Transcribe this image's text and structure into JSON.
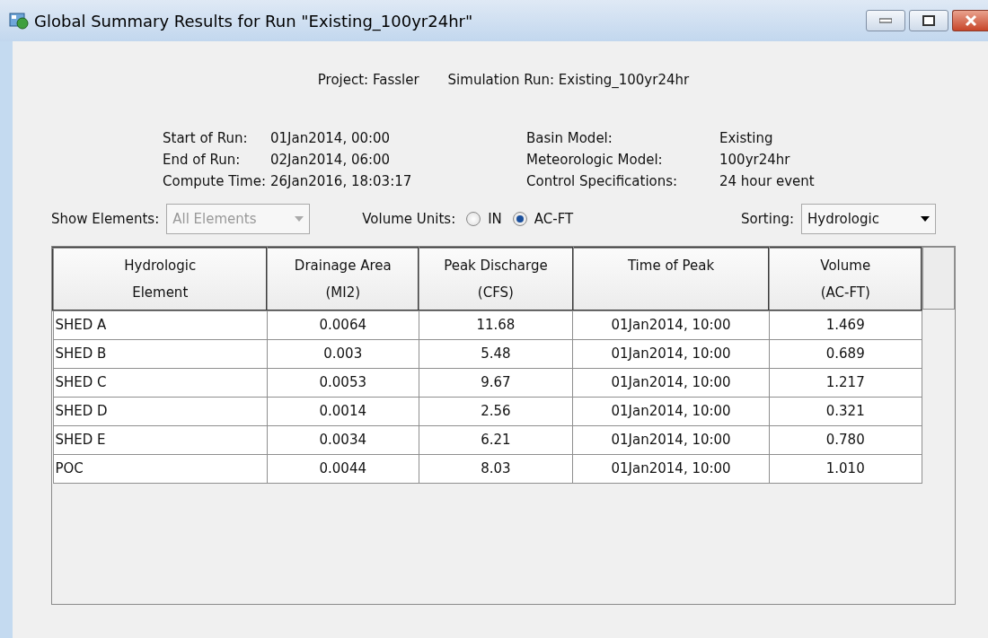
{
  "window": {
    "title": "Global Summary Results for Run \"Existing_100yr24hr\""
  },
  "header": {
    "project": {
      "label": "Project:",
      "value": "Fassler"
    },
    "simulation_run": {
      "label": "Simulation Run:",
      "value": "Existing_100yr24hr"
    }
  },
  "run_info_left": [
    {
      "label": "Start of Run:",
      "value": "01Jan2014, 00:00"
    },
    {
      "label": "End of Run:",
      "value": "02Jan2014, 06:00"
    },
    {
      "label": "Compute Time:",
      "value": "26Jan2016, 18:03:17"
    }
  ],
  "run_info_right": [
    {
      "label": "Basin Model:",
      "value": "Existing"
    },
    {
      "label": "Meteorologic Model:",
      "value": "100yr24hr"
    },
    {
      "label": "Control Specifications:",
      "value": "24 hour event"
    }
  ],
  "show_elements": {
    "label": "Show Elements:",
    "value": "All Elements",
    "disabled": true
  },
  "volume_units": {
    "label": "Volume Units:",
    "options": [
      {
        "label": "IN",
        "selected": false
      },
      {
        "label": "AC-FT",
        "selected": true
      }
    ]
  },
  "sorting": {
    "label": "Sorting:",
    "value": "Hydrologic"
  },
  "table": {
    "columns": [
      "Hydrologic\nElement",
      "Drainage Area\n(MI2)",
      "Peak Discharge\n(CFS)",
      "Time of Peak",
      "Volume\n(AC-FT)"
    ],
    "rows": [
      [
        "SHED A",
        "0.0064",
        "11.68",
        "01Jan2014, 10:00",
        "1.469"
      ],
      [
        "SHED B",
        "0.003",
        "5.48",
        "01Jan2014, 10:00",
        "0.689"
      ],
      [
        "SHED C",
        "0.0053",
        "9.67",
        "01Jan2014, 10:00",
        "1.217"
      ],
      [
        "SHED D",
        "0.0014",
        "2.56",
        "01Jan2014, 10:00",
        "0.321"
      ],
      [
        "SHED E",
        "0.0034",
        "6.21",
        "01Jan2014, 10:00",
        "0.780"
      ],
      [
        "POC",
        "0.0044",
        "8.03",
        "01Jan2014, 10:00",
        "1.010"
      ]
    ]
  }
}
